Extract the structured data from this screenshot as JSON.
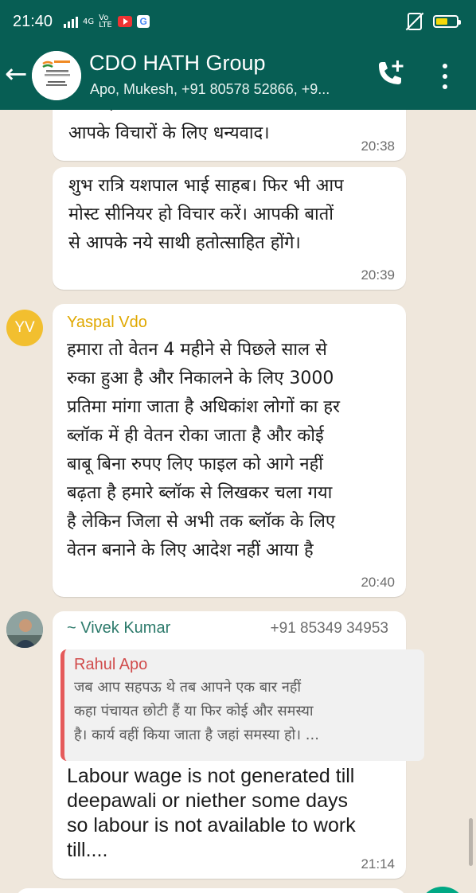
{
  "status_bar": {
    "time": "21:40",
    "network": "4G",
    "volte": "Vo LTE",
    "battery_level_fraction": 0.6
  },
  "header": {
    "title": "CDO HATH Group",
    "subtitle": "Apo, Mukesh, +91 80578 52866, +9..."
  },
  "messages": [
    {
      "text_partial_top": "जाना होता।",
      "text": "आपके विचारों के लिए धन्यवाद।",
      "time": "20:38"
    },
    {
      "lines": [
        "शुभ रात्रि यशपाल भाई साहब। फिर भी आप",
        "मोस्ट सीनियर हो विचार करें। आपकी बातों",
        "से आपके नये साथी हतोत्साहित होंगे।"
      ],
      "time": "20:39"
    },
    {
      "avatar_initials": "YV",
      "sender": "Yaspal Vdo",
      "sender_color": "#e0a800",
      "lines": [
        "हमारा तो वेतन 4 महीने से पिछले साल से",
        "रुका हुआ है और निकालने के लिए 3000",
        "प्रतिमा मांगा जाता है अधिकांश लोगों का हर",
        "ब्लॉक में ही वेतन रोका जाता है और कोई",
        "बाबू बिना रुपए लिए फाइल को आगे नहीं",
        "बढ़ता है हमारे ब्लॉक से लिखकर चला गया",
        "है लेकिन जिला से अभी तक ब्लॉक के लिए",
        "वेतन बनाने के लिए आदेश नहीं आया है"
      ],
      "time": "20:40"
    },
    {
      "sender": "~ Vivek Kumar",
      "sender_color": "#2c7a6b",
      "phone": "+91 85349 34953",
      "quote": {
        "sender": "Rahul Apo",
        "lines": [
          "जब आप सहपऊ थे तब आपने एक बार नहीं",
          "कहा पंचायत छोटी हैं या फिर कोई और समस्या",
          "है। कार्य वहीं किया जाता है जहां समस्या हो। ..."
        ]
      },
      "lines": [
        "Labour wage is not generated till",
        "deepawali or niether some days",
        "so labour is not available to work",
        "till...."
      ],
      "time": "21:14"
    }
  ],
  "colors": {
    "header_bg": "#075e54",
    "chat_bg": "#efe7dc",
    "bubble_bg": "#ffffff",
    "quote_accent": "#e55a5a"
  }
}
